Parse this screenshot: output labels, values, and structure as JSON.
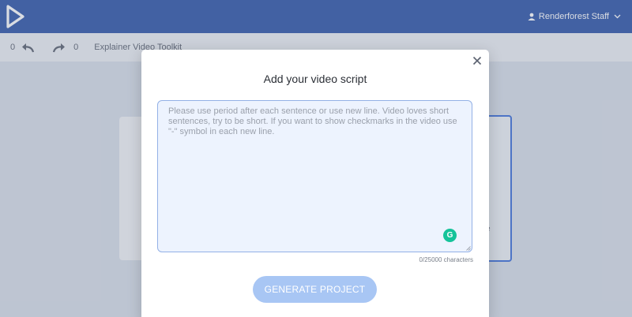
{
  "header": {
    "user_name": "Renderforest Staff"
  },
  "toolbar": {
    "undo_count": "0",
    "redo_count": "0",
    "project_title": "Explainer Video Toolkit"
  },
  "modal": {
    "title": "Add your video script",
    "textarea_value": "",
    "textarea_placeholder": "Please use period after each sentence or use new line. Video loves short sentences, try to be short. If you want to show checkmarks in the video use \"-\" symbol in each new line.",
    "char_counter": "0/25000 characters",
    "generate_label": "GENERATE PROJECT"
  },
  "colors": {
    "topbar": "#2f55a8",
    "accent": "#3d6fd8",
    "button": "#a8c6f4",
    "grammarly": "#15c39a"
  },
  "icons": {
    "logo": "play-triangle-logo-icon",
    "user": "user-icon",
    "dropdown": "chevron-down-icon",
    "undo": "undo-arrow-icon",
    "redo": "redo-arrow-icon",
    "close": "close-icon",
    "grammarly": "grammarly-icon",
    "resize": "resize-handle-icon"
  }
}
